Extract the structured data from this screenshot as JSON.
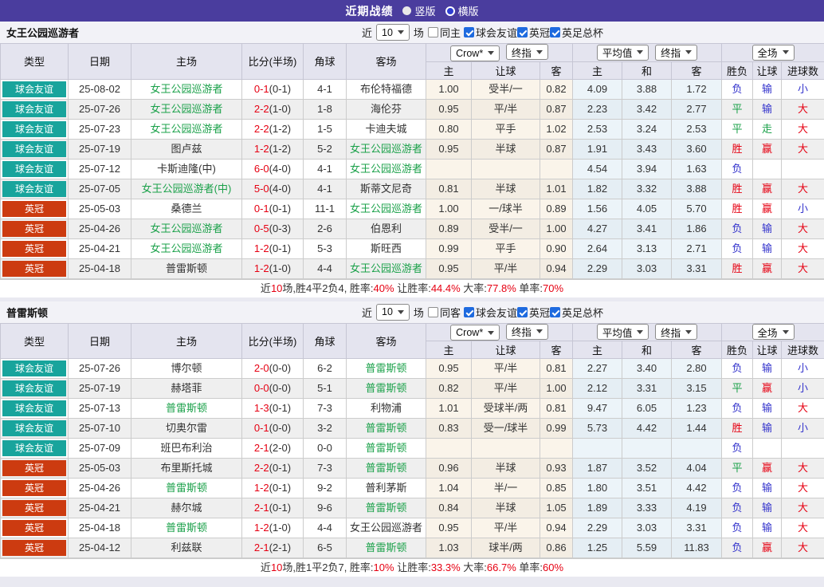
{
  "title_bar": {
    "title": "近期战绩",
    "radios": [
      {
        "label": "竖版",
        "checked": false
      },
      {
        "label": "横版",
        "checked": true
      }
    ]
  },
  "table_header": {
    "cols": [
      "类型",
      "日期",
      "主场",
      "比分(半场)",
      "角球",
      "客场"
    ],
    "sub": [
      "主",
      "让球",
      "客",
      "主",
      "和",
      "客",
      "胜负",
      "让球",
      "进球数"
    ],
    "selects": {
      "company": "Crow*",
      "final1": "终指",
      "avg": "平均值",
      "final2": "终指",
      "scope": "全场"
    }
  },
  "colors": {
    "topbar": "#4a3d9e",
    "type_colors": {
      "球会友谊": "#18a49c",
      "英冠": "#cc3b10"
    },
    "result_colors": {
      "胜": "red",
      "赢": "red",
      "大": "red",
      "平": "green",
      "走": "green",
      "负": "blue",
      "输": "blue",
      "小": "blue"
    },
    "accent_red": "#e60012",
    "accent_blue": "#3333cc",
    "accent_green": "#1ba14a"
  },
  "sections": [
    {
      "team": "女王公园巡游者",
      "filters": {
        "near": "近",
        "count": "10",
        "unit": "场",
        "same": {
          "label": "同主",
          "checked": false
        },
        "comps": [
          {
            "label": "球会友谊",
            "checked": true
          },
          {
            "label": "英冠",
            "checked": true
          },
          {
            "label": "英足总杯",
            "checked": true
          }
        ]
      },
      "rows": [
        {
          "type": "球会友谊",
          "date": "25-08-02",
          "home": "女王公园巡游者",
          "home_green": true,
          "score": "0-1",
          "half": "(0-1)",
          "corner": "4-1",
          "away": "布伦特福德",
          "away_green": false,
          "o1": "1.00",
          "hc": "受半/一",
          "o2": "0.82",
          "a1": "4.09",
          "a2": "3.88",
          "a3": "1.72",
          "r1": "负",
          "r2": "输",
          "r3": "小"
        },
        {
          "type": "球会友谊",
          "date": "25-07-26",
          "home": "女王公园巡游者",
          "home_green": true,
          "score": "2-2",
          "half": "(1-0)",
          "corner": "1-8",
          "away": "海伦芬",
          "away_green": false,
          "o1": "0.95",
          "hc": "平/半",
          "o2": "0.87",
          "a1": "2.23",
          "a2": "3.42",
          "a3": "2.77",
          "r1": "平",
          "r2": "输",
          "r3": "大"
        },
        {
          "type": "球会友谊",
          "date": "25-07-23",
          "home": "女王公园巡游者",
          "home_green": true,
          "score": "2-2",
          "half": "(1-2)",
          "corner": "1-5",
          "away": "卡迪夫城",
          "away_green": false,
          "o1": "0.80",
          "hc": "平手",
          "o2": "1.02",
          "a1": "2.53",
          "a2": "3.24",
          "a3": "2.53",
          "r1": "平",
          "r2": "走",
          "r3": "大"
        },
        {
          "type": "球会友谊",
          "date": "25-07-19",
          "home": "图卢兹",
          "home_green": false,
          "score": "1-2",
          "half": "(1-2)",
          "corner": "5-2",
          "away": "女王公园巡游者",
          "away_green": true,
          "o1": "0.95",
          "hc": "半球",
          "o2": "0.87",
          "a1": "1.91",
          "a2": "3.43",
          "a3": "3.60",
          "r1": "胜",
          "r2": "赢",
          "r3": "大"
        },
        {
          "type": "球会友谊",
          "date": "25-07-12",
          "home": "卡斯迪隆(中)",
          "home_green": false,
          "score": "6-0",
          "half": "(4-0)",
          "corner": "4-1",
          "away": "女王公园巡游者",
          "away_green": true,
          "o1": "",
          "hc": "",
          "o2": "",
          "a1": "4.54",
          "a2": "3.94",
          "a3": "1.63",
          "r1": "负",
          "r2": "",
          "r3": ""
        },
        {
          "type": "球会友谊",
          "date": "25-07-05",
          "home": "女王公园巡游者(中)",
          "home_green": true,
          "score": "5-0",
          "half": "(4-0)",
          "corner": "4-1",
          "away": "斯蒂文尼奇",
          "away_green": false,
          "o1": "0.81",
          "hc": "半球",
          "o2": "1.01",
          "a1": "1.82",
          "a2": "3.32",
          "a3": "3.88",
          "r1": "胜",
          "r2": "赢",
          "r3": "大"
        },
        {
          "type": "英冠",
          "date": "25-05-03",
          "home": "桑德兰",
          "home_green": false,
          "score": "0-1",
          "half": "(0-1)",
          "corner": "11-1",
          "away": "女王公园巡游者",
          "away_green": true,
          "o1": "1.00",
          "hc": "一/球半",
          "o2": "0.89",
          "a1": "1.56",
          "a2": "4.05",
          "a3": "5.70",
          "r1": "胜",
          "r2": "赢",
          "r3": "小"
        },
        {
          "type": "英冠",
          "date": "25-04-26",
          "home": "女王公园巡游者",
          "home_green": true,
          "score": "0-5",
          "half": "(0-3)",
          "corner": "2-6",
          "away": "伯恩利",
          "away_green": false,
          "o1": "0.89",
          "hc": "受半/一",
          "o2": "1.00",
          "a1": "4.27",
          "a2": "3.41",
          "a3": "1.86",
          "r1": "负",
          "r2": "输",
          "r3": "大"
        },
        {
          "type": "英冠",
          "date": "25-04-21",
          "home": "女王公园巡游者",
          "home_green": true,
          "score": "1-2",
          "half": "(0-1)",
          "corner": "5-3",
          "away": "斯旺西",
          "away_green": false,
          "o1": "0.99",
          "hc": "平手",
          "o2": "0.90",
          "a1": "2.64",
          "a2": "3.13",
          "a3": "2.71",
          "r1": "负",
          "r2": "输",
          "r3": "大"
        },
        {
          "type": "英冠",
          "date": "25-04-18",
          "home": "普雷斯顿",
          "home_green": false,
          "score": "1-2",
          "half": "(1-0)",
          "corner": "4-4",
          "away": "女王公园巡游者",
          "away_green": true,
          "o1": "0.95",
          "hc": "平/半",
          "o2": "0.94",
          "a1": "2.29",
          "a2": "3.03",
          "a3": "3.31",
          "r1": "胜",
          "r2": "赢",
          "r3": "大"
        }
      ],
      "summary": [
        {
          "text": "近",
          "red": false
        },
        {
          "text": "10",
          "red": true
        },
        {
          "text": "场,胜4平2负4, 胜率:",
          "red": false
        },
        {
          "text": "40%",
          "red": true
        },
        {
          "text": " 让胜率:",
          "red": false
        },
        {
          "text": "44.4%",
          "red": true
        },
        {
          "text": " 大率:",
          "red": false
        },
        {
          "text": "77.8%",
          "red": true
        },
        {
          "text": " 单率:",
          "red": false
        },
        {
          "text": "70%",
          "red": true
        }
      ]
    },
    {
      "team": "普雷斯顿",
      "filters": {
        "near": "近",
        "count": "10",
        "unit": "场",
        "same": {
          "label": "同客",
          "checked": false
        },
        "comps": [
          {
            "label": "球会友谊",
            "checked": true
          },
          {
            "label": "英冠",
            "checked": true
          },
          {
            "label": "英足总杯",
            "checked": true
          }
        ]
      },
      "rows": [
        {
          "type": "球会友谊",
          "date": "25-07-26",
          "home": "博尔顿",
          "home_green": false,
          "score": "2-0",
          "half": "(0-0)",
          "corner": "6-2",
          "away": "普雷斯顿",
          "away_green": true,
          "o1": "0.95",
          "hc": "平/半",
          "o2": "0.81",
          "a1": "2.27",
          "a2": "3.40",
          "a3": "2.80",
          "r1": "负",
          "r2": "输",
          "r3": "小"
        },
        {
          "type": "球会友谊",
          "date": "25-07-19",
          "home": "赫塔菲",
          "home_green": false,
          "score": "0-0",
          "half": "(0-0)",
          "corner": "5-1",
          "away": "普雷斯顿",
          "away_green": true,
          "o1": "0.82",
          "hc": "平/半",
          "o2": "1.00",
          "a1": "2.12",
          "a2": "3.31",
          "a3": "3.15",
          "r1": "平",
          "r2": "赢",
          "r3": "小"
        },
        {
          "type": "球会友谊",
          "date": "25-07-13",
          "home": "普雷斯顿",
          "home_green": true,
          "score": "1-3",
          "half": "(0-1)",
          "corner": "7-3",
          "away": "利物浦",
          "away_green": false,
          "o1": "1.01",
          "hc": "受球半/两",
          "o2": "0.81",
          "a1": "9.47",
          "a2": "6.05",
          "a3": "1.23",
          "r1": "负",
          "r2": "输",
          "r3": "大"
        },
        {
          "type": "球会友谊",
          "date": "25-07-10",
          "home": "切奥尔雷",
          "home_green": false,
          "score": "0-1",
          "half": "(0-0)",
          "corner": "3-2",
          "away": "普雷斯顿",
          "away_green": true,
          "o1": "0.83",
          "hc": "受一/球半",
          "o2": "0.99",
          "a1": "5.73",
          "a2": "4.42",
          "a3": "1.44",
          "r1": "胜",
          "r2": "输",
          "r3": "小"
        },
        {
          "type": "球会友谊",
          "date": "25-07-09",
          "home": "班巴布利治",
          "home_green": false,
          "score": "2-1",
          "half": "(2-0)",
          "corner": "0-0",
          "away": "普雷斯顿",
          "away_green": true,
          "o1": "",
          "hc": "",
          "o2": "",
          "a1": "",
          "a2": "",
          "a3": "",
          "r1": "负",
          "r2": "",
          "r3": ""
        },
        {
          "type": "英冠",
          "date": "25-05-03",
          "home": "布里斯托城",
          "home_green": false,
          "score": "2-2",
          "half": "(0-1)",
          "corner": "7-3",
          "away": "普雷斯顿",
          "away_green": true,
          "o1": "0.96",
          "hc": "半球",
          "o2": "0.93",
          "a1": "1.87",
          "a2": "3.52",
          "a3": "4.04",
          "r1": "平",
          "r2": "赢",
          "r3": "大"
        },
        {
          "type": "英冠",
          "date": "25-04-26",
          "home": "普雷斯顿",
          "home_green": true,
          "score": "1-2",
          "half": "(0-1)",
          "corner": "9-2",
          "away": "普利茅斯",
          "away_green": false,
          "o1": "1.04",
          "hc": "半/一",
          "o2": "0.85",
          "a1": "1.80",
          "a2": "3.51",
          "a3": "4.42",
          "r1": "负",
          "r2": "输",
          "r3": "大"
        },
        {
          "type": "英冠",
          "date": "25-04-21",
          "home": "赫尔城",
          "home_green": false,
          "score": "2-1",
          "half": "(0-1)",
          "corner": "9-6",
          "away": "普雷斯顿",
          "away_green": true,
          "o1": "0.84",
          "hc": "半球",
          "o2": "1.05",
          "a1": "1.89",
          "a2": "3.33",
          "a3": "4.19",
          "r1": "负",
          "r2": "输",
          "r3": "大"
        },
        {
          "type": "英冠",
          "date": "25-04-18",
          "home": "普雷斯顿",
          "home_green": true,
          "score": "1-2",
          "half": "(1-0)",
          "corner": "4-4",
          "away": "女王公园巡游者",
          "away_green": false,
          "o1": "0.95",
          "hc": "平/半",
          "o2": "0.94",
          "a1": "2.29",
          "a2": "3.03",
          "a3": "3.31",
          "r1": "负",
          "r2": "输",
          "r3": "大"
        },
        {
          "type": "英冠",
          "date": "25-04-12",
          "home": "利兹联",
          "home_green": false,
          "score": "2-1",
          "half": "(2-1)",
          "corner": "6-5",
          "away": "普雷斯顿",
          "away_green": true,
          "o1": "1.03",
          "hc": "球半/两",
          "o2": "0.86",
          "a1": "1.25",
          "a2": "5.59",
          "a3": "11.83",
          "r1": "负",
          "r2": "赢",
          "r3": "大"
        }
      ],
      "summary": [
        {
          "text": "近",
          "red": false
        },
        {
          "text": "10",
          "red": true
        },
        {
          "text": "场,胜1平2负7, 胜率:",
          "red": false
        },
        {
          "text": "10%",
          "red": true
        },
        {
          "text": " 让胜率:",
          "red": false
        },
        {
          "text": "33.3%",
          "red": true
        },
        {
          "text": " 大率:",
          "red": false
        },
        {
          "text": "66.7%",
          "red": true
        },
        {
          "text": " 单率:",
          "red": false
        },
        {
          "text": "60%",
          "red": true
        }
      ]
    }
  ]
}
